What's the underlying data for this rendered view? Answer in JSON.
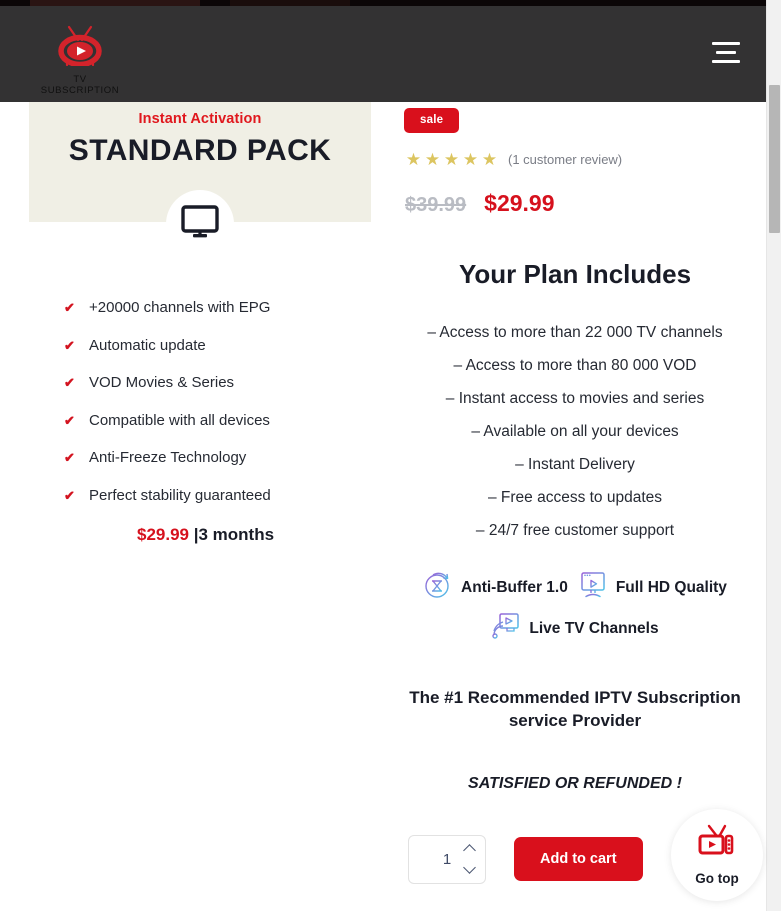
{
  "header": {
    "brand_name": "TV SUBSCRIPTION",
    "logo_icon": "tv-play-logo-icon",
    "menu_icon": "hamburger-menu-icon"
  },
  "pack_card": {
    "kicker": "Instant Activation",
    "title": "STANDARD PACK",
    "icon": "monitor-icon",
    "features": [
      "+20000 channels with EPG",
      "Automatic update",
      "VOD Movies & Series",
      "Compatible with all devices",
      "Anti-Freeze Technology",
      "Perfect stability guaranteed"
    ],
    "tick_icon": "check-icon",
    "price": "$29.99",
    "period": "|3 months"
  },
  "product": {
    "sale_badge": "sale",
    "rating_stars": 5,
    "star_icon": "star-icon",
    "review_count": "(1 customer review)",
    "old_price": "$39.99",
    "new_price": "$29.99",
    "plan_heading": "Your Plan Includes",
    "plan_items": [
      "– Access to more than 22 000 TV channels",
      "– Access to more than 80 000 VOD",
      "– Instant access to movies and series",
      "– Available on all your devices",
      "– Instant Delivery",
      "– Free access to updates",
      "– 24/7 free customer support"
    ],
    "badges": [
      {
        "label": "Anti-Buffer 1.0",
        "icon": "hourglass-refresh-icon"
      },
      {
        "label": "Full HD Quality",
        "icon": "monitor-play-icon"
      },
      {
        "label": "Live TV Channels",
        "icon": "broadcast-monitor-icon"
      }
    ],
    "recommend_line1": "The #1 Recommended IPTV Subscription",
    "recommend_line2": "service Provider",
    "satisfied": "SATISFIED OR REFUNDED !",
    "quantity_value": "1",
    "quantity_placeholder": "1",
    "increase_icon": "chevron-up-icon",
    "decrease_icon": "chevron-down-icon",
    "add_to_cart": "Add to cart"
  },
  "go_top": {
    "label": "Go top",
    "icon": "retro-tv-icon"
  },
  "colors": {
    "brand_red": "#d9101c",
    "header_bg": "#333233",
    "card_bg": "#f0efe5",
    "star_gold": "#dcc560",
    "text_dark": "#191c27",
    "badge_purple": "#9a63d8",
    "badge_blue": "#4fc3e8"
  }
}
